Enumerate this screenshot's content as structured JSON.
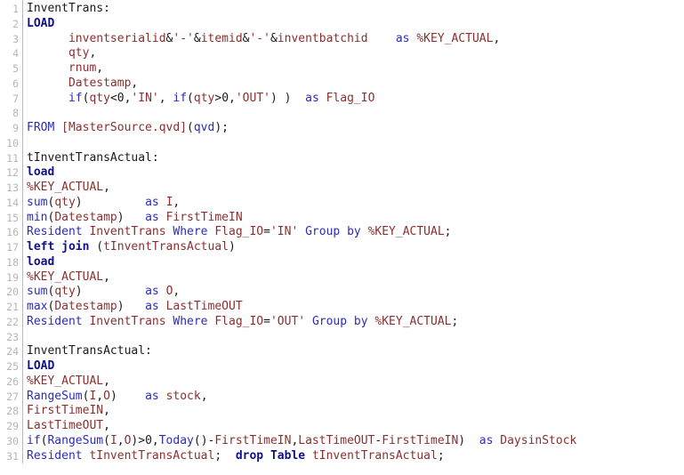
{
  "editor": {
    "name": "qlikview-script-editor",
    "background": "#ffffff",
    "gutter_color": "#b5b5b5",
    "gutter_rule_color": "#b9b9b9",
    "colors": {
      "keyword": "#2b2bbd",
      "keyword_bold": "#10108f",
      "identifier": "#8a2f2f",
      "string": "#8a2f2f",
      "plain": "#1a1a1a"
    },
    "line_count": 31,
    "line_numbers": [
      "1",
      "2",
      "3",
      "4",
      "5",
      "6",
      "7",
      "8",
      "9",
      "10",
      "11",
      "12",
      "13",
      "14",
      "15",
      "16",
      "17",
      "18",
      "19",
      "20",
      "21",
      "22",
      "23",
      "24",
      "25",
      "26",
      "27",
      "28",
      "29",
      "30",
      "31"
    ],
    "lines": [
      {
        "n": 1,
        "text": "InventTrans:",
        "tokens": [
          {
            "t": "InventTrans:",
            "c": "plain"
          }
        ]
      },
      {
        "n": 2,
        "text": "LOAD",
        "tokens": [
          {
            "t": "LOAD",
            "c": "kwb"
          }
        ]
      },
      {
        "n": 3,
        "text": "      inventserialid&'-'&itemid&'-'&inventbatchid    as %KEY_ACTUAL,",
        "tokens": [
          {
            "t": "      ",
            "c": "plain"
          },
          {
            "t": "inventserialid",
            "c": "id"
          },
          {
            "t": "&",
            "c": "punct"
          },
          {
            "t": "'-'",
            "c": "str"
          },
          {
            "t": "&",
            "c": "punct"
          },
          {
            "t": "itemid",
            "c": "id"
          },
          {
            "t": "&",
            "c": "punct"
          },
          {
            "t": "'-'",
            "c": "str"
          },
          {
            "t": "&",
            "c": "punct"
          },
          {
            "t": "inventbatchid",
            "c": "id"
          },
          {
            "t": "    ",
            "c": "plain"
          },
          {
            "t": "as",
            "c": "kw"
          },
          {
            "t": " ",
            "c": "plain"
          },
          {
            "t": "%KEY_ACTUAL",
            "c": "key"
          },
          {
            "t": ",",
            "c": "punct"
          }
        ]
      },
      {
        "n": 4,
        "text": "      qty,",
        "tokens": [
          {
            "t": "      ",
            "c": "plain"
          },
          {
            "t": "qty",
            "c": "id"
          },
          {
            "t": ",",
            "c": "punct"
          }
        ]
      },
      {
        "n": 5,
        "text": "      rnum,",
        "tokens": [
          {
            "t": "      ",
            "c": "plain"
          },
          {
            "t": "rnum",
            "c": "id"
          },
          {
            "t": ",",
            "c": "punct"
          }
        ]
      },
      {
        "n": 6,
        "text": "      Datestamp,",
        "tokens": [
          {
            "t": "      ",
            "c": "plain"
          },
          {
            "t": "Datestamp",
            "c": "id"
          },
          {
            "t": ",",
            "c": "punct"
          }
        ]
      },
      {
        "n": 7,
        "text": "      if(qty<0,'IN', if(qty>0,'OUT') )  as Flag_IO",
        "tokens": [
          {
            "t": "      ",
            "c": "plain"
          },
          {
            "t": "if",
            "c": "fn"
          },
          {
            "t": "(",
            "c": "punct"
          },
          {
            "t": "qty",
            "c": "id"
          },
          {
            "t": "<",
            "c": "punct"
          },
          {
            "t": "0",
            "c": "num"
          },
          {
            "t": ",",
            "c": "punct"
          },
          {
            "t": "'IN'",
            "c": "str"
          },
          {
            "t": ", ",
            "c": "punct"
          },
          {
            "t": "if",
            "c": "fn"
          },
          {
            "t": "(",
            "c": "punct"
          },
          {
            "t": "qty",
            "c": "id"
          },
          {
            "t": ">",
            "c": "punct"
          },
          {
            "t": "0",
            "c": "num"
          },
          {
            "t": ",",
            "c": "punct"
          },
          {
            "t": "'OUT'",
            "c": "str"
          },
          {
            "t": ") )",
            "c": "punct"
          },
          {
            "t": "  ",
            "c": "plain"
          },
          {
            "t": "as",
            "c": "kw"
          },
          {
            "t": " ",
            "c": "plain"
          },
          {
            "t": "Flag_IO",
            "c": "id"
          }
        ]
      },
      {
        "n": 8,
        "text": "",
        "tokens": []
      },
      {
        "n": 9,
        "text": "FROM [MasterSource.qvd](qvd);",
        "tokens": [
          {
            "t": "FROM",
            "c": "kw"
          },
          {
            "t": " ",
            "c": "plain"
          },
          {
            "t": "[MasterSource.qvd]",
            "c": "file"
          },
          {
            "t": "(",
            "c": "punct"
          },
          {
            "t": "qvd",
            "c": "kw"
          },
          {
            "t": ");",
            "c": "punct"
          }
        ]
      },
      {
        "n": 10,
        "text": "",
        "tokens": []
      },
      {
        "n": 11,
        "text": "tInventTransActual:",
        "tokens": [
          {
            "t": "tInventTransActual:",
            "c": "plain"
          }
        ]
      },
      {
        "n": 12,
        "text": "load",
        "tokens": [
          {
            "t": "load",
            "c": "kwb"
          }
        ]
      },
      {
        "n": 13,
        "text": "%KEY_ACTUAL,",
        "tokens": [
          {
            "t": "%KEY_ACTUAL",
            "c": "key"
          },
          {
            "t": ",",
            "c": "punct"
          }
        ]
      },
      {
        "n": 14,
        "text": "sum(qty)         as I,",
        "tokens": [
          {
            "t": "sum",
            "c": "fn"
          },
          {
            "t": "(",
            "c": "punct"
          },
          {
            "t": "qty",
            "c": "id"
          },
          {
            "t": ")",
            "c": "punct"
          },
          {
            "t": "         ",
            "c": "plain"
          },
          {
            "t": "as",
            "c": "kw"
          },
          {
            "t": " ",
            "c": "plain"
          },
          {
            "t": "I",
            "c": "id"
          },
          {
            "t": ",",
            "c": "punct"
          }
        ]
      },
      {
        "n": 15,
        "text": "min(Datestamp)   as FirstTimeIN",
        "tokens": [
          {
            "t": "min",
            "c": "fn"
          },
          {
            "t": "(",
            "c": "punct"
          },
          {
            "t": "Datestamp",
            "c": "id"
          },
          {
            "t": ")",
            "c": "punct"
          },
          {
            "t": "   ",
            "c": "plain"
          },
          {
            "t": "as",
            "c": "kw"
          },
          {
            "t": " ",
            "c": "plain"
          },
          {
            "t": "FirstTimeIN",
            "c": "id"
          }
        ]
      },
      {
        "n": 16,
        "text": "Resident InventTrans Where Flag_IO='IN' Group by %KEY_ACTUAL;",
        "tokens": [
          {
            "t": "Resident",
            "c": "kw"
          },
          {
            "t": " ",
            "c": "plain"
          },
          {
            "t": "InventTrans",
            "c": "id"
          },
          {
            "t": " ",
            "c": "plain"
          },
          {
            "t": "Where",
            "c": "kw"
          },
          {
            "t": " ",
            "c": "plain"
          },
          {
            "t": "Flag_IO",
            "c": "id"
          },
          {
            "t": "=",
            "c": "punct"
          },
          {
            "t": "'IN'",
            "c": "str"
          },
          {
            "t": " ",
            "c": "plain"
          },
          {
            "t": "Group by",
            "c": "kw"
          },
          {
            "t": " ",
            "c": "plain"
          },
          {
            "t": "%KEY_ACTUAL",
            "c": "key"
          },
          {
            "t": ";",
            "c": "punct"
          }
        ]
      },
      {
        "n": 17,
        "text": "left join (tInventTransActual)",
        "tokens": [
          {
            "t": "left join",
            "c": "kwb"
          },
          {
            "t": " (",
            "c": "punct"
          },
          {
            "t": "tInventTransActual",
            "c": "id"
          },
          {
            "t": ")",
            "c": "punct"
          }
        ]
      },
      {
        "n": 18,
        "text": "load",
        "tokens": [
          {
            "t": "load",
            "c": "kwb"
          }
        ]
      },
      {
        "n": 19,
        "text": "%KEY_ACTUAL,",
        "tokens": [
          {
            "t": "%KEY_ACTUAL",
            "c": "key"
          },
          {
            "t": ",",
            "c": "punct"
          }
        ]
      },
      {
        "n": 20,
        "text": "sum(qty)         as O,",
        "tokens": [
          {
            "t": "sum",
            "c": "fn"
          },
          {
            "t": "(",
            "c": "punct"
          },
          {
            "t": "qty",
            "c": "id"
          },
          {
            "t": ")",
            "c": "punct"
          },
          {
            "t": "         ",
            "c": "plain"
          },
          {
            "t": "as",
            "c": "kw"
          },
          {
            "t": " ",
            "c": "plain"
          },
          {
            "t": "O",
            "c": "id"
          },
          {
            "t": ",",
            "c": "punct"
          }
        ]
      },
      {
        "n": 21,
        "text": "max(Datestamp)   as LastTimeOUT",
        "tokens": [
          {
            "t": "max",
            "c": "fn"
          },
          {
            "t": "(",
            "c": "punct"
          },
          {
            "t": "Datestamp",
            "c": "id"
          },
          {
            "t": ")",
            "c": "punct"
          },
          {
            "t": "   ",
            "c": "plain"
          },
          {
            "t": "as",
            "c": "kw"
          },
          {
            "t": " ",
            "c": "plain"
          },
          {
            "t": "LastTimeOUT",
            "c": "id"
          }
        ]
      },
      {
        "n": 22,
        "text": "Resident InventTrans Where Flag_IO='OUT' Group by %KEY_ACTUAL;",
        "tokens": [
          {
            "t": "Resident",
            "c": "kw"
          },
          {
            "t": " ",
            "c": "plain"
          },
          {
            "t": "InventTrans",
            "c": "id"
          },
          {
            "t": " ",
            "c": "plain"
          },
          {
            "t": "Where",
            "c": "kw"
          },
          {
            "t": " ",
            "c": "plain"
          },
          {
            "t": "Flag_IO",
            "c": "id"
          },
          {
            "t": "=",
            "c": "punct"
          },
          {
            "t": "'OUT'",
            "c": "str"
          },
          {
            "t": " ",
            "c": "plain"
          },
          {
            "t": "Group by",
            "c": "kw"
          },
          {
            "t": " ",
            "c": "plain"
          },
          {
            "t": "%KEY_ACTUAL",
            "c": "key"
          },
          {
            "t": ";",
            "c": "punct"
          }
        ]
      },
      {
        "n": 23,
        "text": "",
        "tokens": []
      },
      {
        "n": 24,
        "text": "InventTransActual:",
        "tokens": [
          {
            "t": "InventTransActual:",
            "c": "plain"
          }
        ]
      },
      {
        "n": 25,
        "text": "LOAD",
        "tokens": [
          {
            "t": "LOAD",
            "c": "kwb"
          }
        ]
      },
      {
        "n": 26,
        "text": "%KEY_ACTUAL,",
        "tokens": [
          {
            "t": "%KEY_ACTUAL",
            "c": "key"
          },
          {
            "t": ",",
            "c": "punct"
          }
        ]
      },
      {
        "n": 27,
        "text": "RangeSum(I,O)    as stock,",
        "tokens": [
          {
            "t": "RangeSum",
            "c": "fn"
          },
          {
            "t": "(",
            "c": "punct"
          },
          {
            "t": "I",
            "c": "id"
          },
          {
            "t": ",",
            "c": "punct"
          },
          {
            "t": "O",
            "c": "id"
          },
          {
            "t": ")",
            "c": "punct"
          },
          {
            "t": "    ",
            "c": "plain"
          },
          {
            "t": "as",
            "c": "kw"
          },
          {
            "t": " ",
            "c": "plain"
          },
          {
            "t": "stock",
            "c": "id"
          },
          {
            "t": ",",
            "c": "punct"
          }
        ]
      },
      {
        "n": 28,
        "text": "FirstTimeIN,",
        "tokens": [
          {
            "t": "FirstTimeIN",
            "c": "id"
          },
          {
            "t": ",",
            "c": "punct"
          }
        ]
      },
      {
        "n": 29,
        "text": "LastTimeOUT,",
        "tokens": [
          {
            "t": "LastTimeOUT",
            "c": "id"
          },
          {
            "t": ",",
            "c": "punct"
          }
        ]
      },
      {
        "n": 30,
        "text": "if(RangeSum(I,O)>0,Today()-FirstTimeIN,LastTimeOUT-FirstTimeIN)  as DaysinStock",
        "tokens": [
          {
            "t": "if",
            "c": "fn"
          },
          {
            "t": "(",
            "c": "punct"
          },
          {
            "t": "RangeSum",
            "c": "fn"
          },
          {
            "t": "(",
            "c": "punct"
          },
          {
            "t": "I",
            "c": "id"
          },
          {
            "t": ",",
            "c": "punct"
          },
          {
            "t": "O",
            "c": "id"
          },
          {
            "t": ")",
            "c": "punct"
          },
          {
            "t": ">",
            "c": "punct"
          },
          {
            "t": "0",
            "c": "num"
          },
          {
            "t": ",",
            "c": "punct"
          },
          {
            "t": "Today",
            "c": "fn"
          },
          {
            "t": "()",
            "c": "punct"
          },
          {
            "t": "-",
            "c": "punct"
          },
          {
            "t": "FirstTimeIN",
            "c": "id"
          },
          {
            "t": ",",
            "c": "punct"
          },
          {
            "t": "LastTimeOUT",
            "c": "id"
          },
          {
            "t": "-",
            "c": "punct"
          },
          {
            "t": "FirstTimeIN",
            "c": "id"
          },
          {
            "t": ")",
            "c": "punct"
          },
          {
            "t": "  ",
            "c": "plain"
          },
          {
            "t": "as",
            "c": "kw"
          },
          {
            "t": " ",
            "c": "plain"
          },
          {
            "t": "DaysinStock",
            "c": "id"
          }
        ]
      },
      {
        "n": 31,
        "text": "Resident tInventTransActual;  drop Table tInventTransActual;",
        "tokens": [
          {
            "t": "Resident",
            "c": "kw"
          },
          {
            "t": " ",
            "c": "plain"
          },
          {
            "t": "tInventTransActual",
            "c": "id"
          },
          {
            "t": ";",
            "c": "punct"
          },
          {
            "t": "  ",
            "c": "plain"
          },
          {
            "t": "drop Table",
            "c": "kwb"
          },
          {
            "t": " ",
            "c": "plain"
          },
          {
            "t": "tInventTransActual",
            "c": "id"
          },
          {
            "t": ";",
            "c": "punct"
          }
        ]
      }
    ]
  }
}
